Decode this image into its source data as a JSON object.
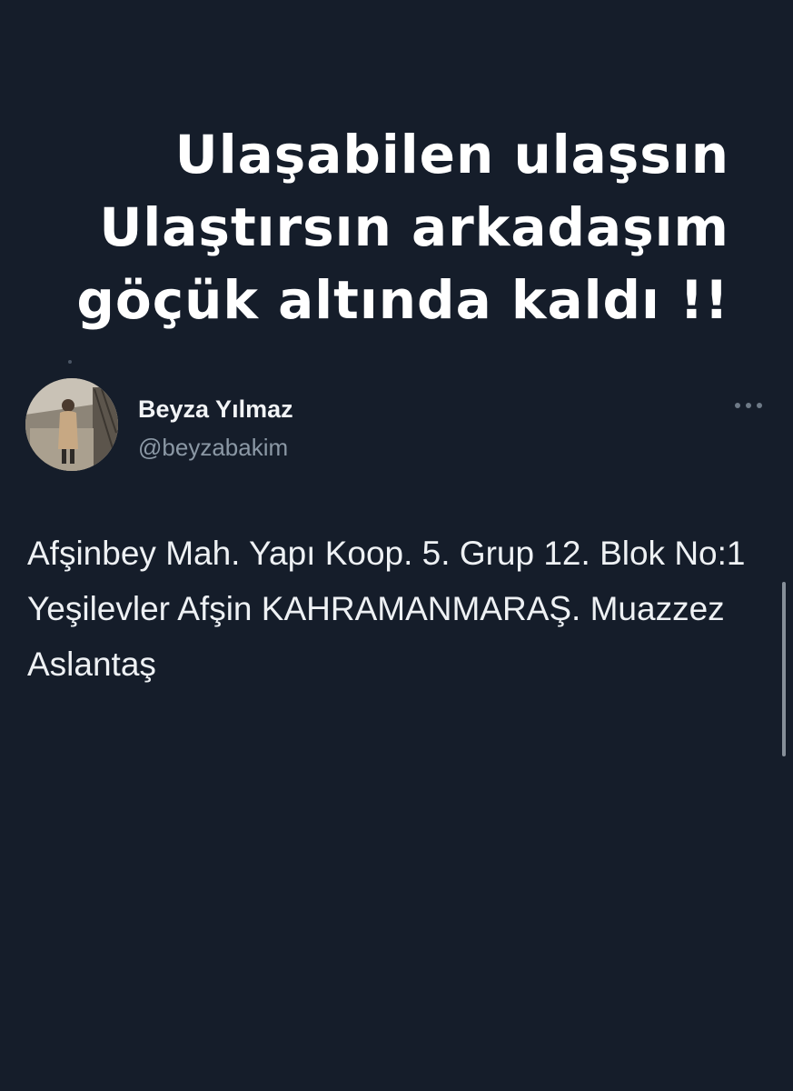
{
  "overlay_caption": {
    "lines": [
      "Ulaşabilen ulaşsın",
      "Ulaştırsın arkadaşım",
      "göçük altında kaldı !!"
    ]
  },
  "tweet": {
    "author": {
      "display_name": "Beyza Yılmaz",
      "username": "@beyzabakim"
    },
    "text": "Afşinbey Mah. Yapı Koop. 5. Grup 12. Blok No:1 Yeşilevler Afşin KAHRAMANMARAŞ. Muazzez Aslantaş"
  },
  "icons": {
    "more": "more-horizontal-icon",
    "avatar": "profile-photo"
  },
  "colors": {
    "background": "#151d2a",
    "primary_text": "#f2f4f6",
    "secondary_text": "#8b98a5"
  }
}
